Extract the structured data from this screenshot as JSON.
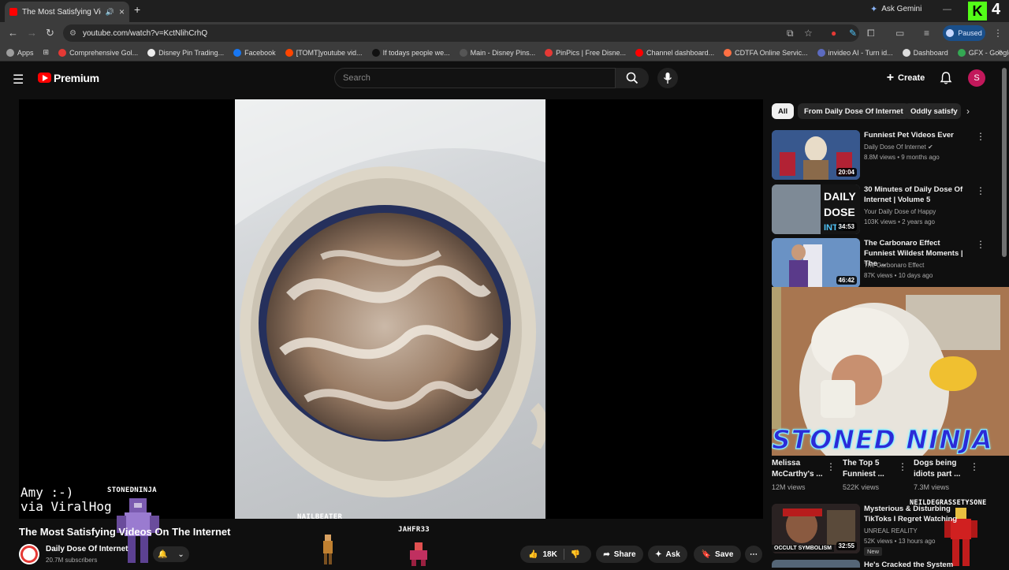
{
  "browser": {
    "tab_title": "The Most Satisfying Videos",
    "ask_gemini": "Ask Gemini",
    "kick_count": "4",
    "url": "youtube.com/watch?v=KctNlihCrhQ",
    "paused_label": "Paused",
    "bookmarks": [
      {
        "label": "Apps",
        "color": "#9e9e9e"
      },
      {
        "label": "Comprehensive Gol...",
        "color": "#e53935"
      },
      {
        "label": "Disney Pin Trading...",
        "color": "#eeeeee"
      },
      {
        "label": "Facebook",
        "color": "#1877f2"
      },
      {
        "label": "[TOMT]youtube vid...",
        "color": "#ff4500"
      },
      {
        "label": "If todays people we...",
        "color": "#111111"
      },
      {
        "label": "Main - Disney Pins...",
        "color": "#555555"
      },
      {
        "label": "PinPics | Free Disne...",
        "color": "#e53935"
      },
      {
        "label": "Channel dashboard...",
        "color": "#ff0000"
      },
      {
        "label": "CDTFA Online Servic...",
        "color": "#ff7043"
      },
      {
        "label": "invideo AI - Turn id...",
        "color": "#5c6bc0"
      },
      {
        "label": "Dashboard",
        "color": "#dddddd"
      },
      {
        "label": "GFX - Google Drive",
        "color": "#34a853"
      }
    ]
  },
  "youtube": {
    "brand": "Premium",
    "search_placeholder": "Search",
    "create_label": "Create",
    "avatar_letter": "S"
  },
  "video": {
    "title": "The Most Satisfying Videos On The Internet",
    "channel": "Daily Dose Of Internet",
    "subscribers": "20.7M subscribers",
    "likes": "18K",
    "share_label": "Share",
    "ask_label": "Ask",
    "save_label": "Save"
  },
  "overlays": {
    "credit_line1": "Amy :-)",
    "credit_line2": "via ViralHog",
    "tags": [
      "STONEDNINJA",
      "NAILBEATER",
      "JAHFR33",
      "NEILDEGRASSETYSONE"
    ],
    "banner": "STONED NINJA"
  },
  "chips": [
    "All",
    "From Daily Dose Of Internet",
    "Oddly satisfy"
  ],
  "recommendations": [
    {
      "title": "Funniest Pet Videos Ever",
      "channel": "Daily Dose Of Internet",
      "meta": "8.8M views • 9 months ago",
      "duration": "20:04",
      "thumb": "#4a6a9c"
    },
    {
      "title": "30 Minutes of Daily Dose Of Internet | Volume 5",
      "channel": "Your Daily Dose of Happy",
      "meta": "103K views • 2 years ago",
      "duration": "34:53",
      "thumb": "#6f7a85"
    },
    {
      "title": "The Carbonaro Effect Funniest Wildest Moments | The ...",
      "channel": "The Carbonaro Effect",
      "meta": "87K views • 10 days ago",
      "duration": "46:42",
      "thumb": "#5a84b8"
    },
    {
      "title": "Mysterious & Disturbing TikToks I Regret Watching",
      "channel": "UNREAL REALITY",
      "meta": "52K views • 13 hours ago",
      "duration": "32:55",
      "badge": "New",
      "thumb_text": "OCCULT SYMBOLISM",
      "thumb": "#3a2a2a"
    },
    {
      "title": "He's Cracked the System",
      "thumb": "#556677"
    }
  ],
  "shorts": [
    {
      "title": "Melissa McCarthy's ...",
      "views": "12M views"
    },
    {
      "title": "The Top 5 Funniest ...",
      "views": "522K views"
    },
    {
      "title": "Dogs being idiots part ...",
      "views": "7.3M views"
    }
  ],
  "colors": {
    "accent": "#ff0000",
    "kick": "#53fc18",
    "avatar": "#c2185b"
  }
}
